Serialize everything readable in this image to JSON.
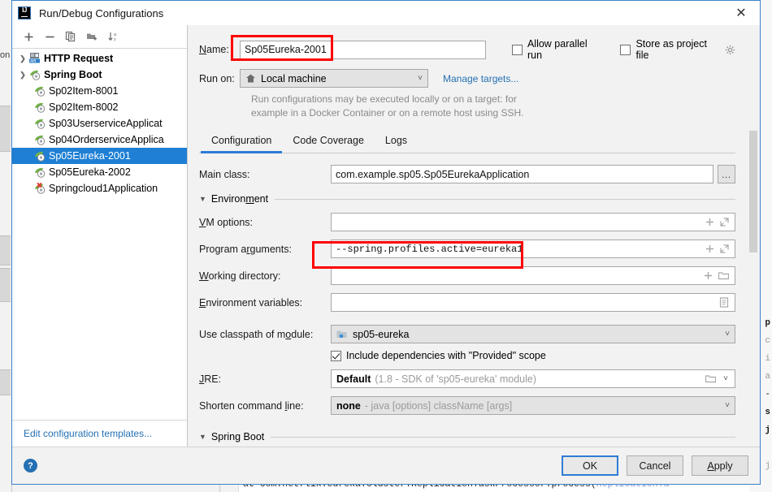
{
  "window": {
    "title": "Run/Debug Configurations",
    "app_icon": "intellij-idea-logo",
    "close_icon": "✕"
  },
  "sidebar": {
    "toolbar": [
      {
        "name": "add-configuration-button",
        "glyph": "+"
      },
      {
        "name": "remove-configuration-button",
        "glyph": "−"
      },
      {
        "name": "copy-configuration-button",
        "glyph": "copy-icon"
      },
      {
        "name": "add-folder-button",
        "glyph": "folder-add-icon"
      },
      {
        "name": "sort-alphabetically-button",
        "glyph": "sort-az-icon"
      }
    ],
    "items": [
      {
        "label": "HTTP Request",
        "icon": "http-api-icon",
        "type": "group",
        "expanded": false,
        "selected": false
      },
      {
        "label": "Spring Boot",
        "icon": "spring-boot-icon",
        "type": "group",
        "expanded": true,
        "selected": false
      },
      {
        "label": "Sp02Item-8001",
        "icon": "spring-boot-icon",
        "type": "leaf",
        "selected": false
      },
      {
        "label": "Sp02Item-8002",
        "icon": "spring-boot-icon",
        "type": "leaf",
        "selected": false
      },
      {
        "label": "Sp03UserserviceApplicat",
        "icon": "spring-boot-icon",
        "type": "leaf",
        "selected": false
      },
      {
        "label": "Sp04OrderserviceApplica",
        "icon": "spring-boot-icon",
        "type": "leaf",
        "selected": false
      },
      {
        "label": "Sp05Eureka-2001",
        "icon": "spring-boot-icon",
        "type": "leaf",
        "selected": true
      },
      {
        "label": "Sp05Eureka-2002",
        "icon": "spring-boot-icon",
        "type": "leaf",
        "selected": false
      },
      {
        "label": "Springcloud1Application",
        "icon": "spring-boot-error-icon",
        "type": "leaf",
        "selected": false
      }
    ],
    "edit_templates_link": "Edit configuration templates..."
  },
  "form": {
    "name_label": "Name:",
    "name_value": "Sp05Eureka-2001",
    "allow_parallel_run_label": "Allow parallel run",
    "allow_parallel_run_checked": false,
    "store_as_project_file_label": "Store as project file",
    "store_as_project_file_checked": false,
    "store_settings_icon": "gear-icon",
    "run_on_label": "Run on:",
    "run_on_value": "Local machine",
    "run_on_icon": "home-icon",
    "manage_targets_link": "Manage targets...",
    "run_on_hint_line1": "Run configurations may be executed locally or on a target: for",
    "run_on_hint_line2": "example in a Docker Container or on a remote host using SSH."
  },
  "tabs": [
    {
      "label": "Configuration",
      "active": true
    },
    {
      "label": "Code Coverage",
      "active": false
    },
    {
      "label": "Logs",
      "active": false
    }
  ],
  "configuration": {
    "main_class_label": "Main class:",
    "main_class_value": "com.example.sp05.Sp05EurekaApplication",
    "main_class_browse": "…",
    "environment_section": "Environment",
    "vm_options_label": "VM options:",
    "vm_options_value": "",
    "program_arguments_label": "Program arguments:",
    "program_arguments_value": "--spring.profiles.active=eureka1",
    "working_directory_label": "Working directory:",
    "working_directory_value": "",
    "environment_variables_label": "Environment variables:",
    "environment_variables_value": "",
    "use_classpath_label": "Use classpath of module:",
    "use_classpath_value": "sp05-eureka",
    "use_classpath_icon": "module-icon",
    "include_provided_label": "Include dependencies with \"Provided\" scope",
    "include_provided_checked": true,
    "jre_label": "JRE:",
    "jre_value": "Default",
    "jre_value_hint": "(1.8 - SDK of 'sp05-eureka' module)",
    "shorten_cmd_label": "Shorten command line:",
    "shorten_cmd_value": "none",
    "shorten_cmd_hint": "- java [options] className [args]",
    "spring_boot_section": "Spring Boot",
    "field_icons": {
      "add": "plus-icon",
      "expand": "expand-icon",
      "folder": "folder-icon",
      "list": "list-icon"
    }
  },
  "footer": {
    "help_label": "?",
    "ok_label": "OK",
    "cancel_label": "Cancel",
    "apply_label": "Apply"
  },
  "annotations": [
    {
      "name": "name-field-highlight",
      "color": "#ff0000"
    },
    {
      "name": "program-arguments-highlight",
      "color": "#ff0000"
    }
  ],
  "background": {
    "left_label": "on",
    "console_text": "at com.netflix.eureka.cluster.ReplicationTaskProcessor.process(",
    "console_link": "ReplicationTa",
    "code_fragments": [
      "p",
      "c",
      "i",
      "a",
      "-",
      "s",
      "j",
      "j"
    ]
  }
}
